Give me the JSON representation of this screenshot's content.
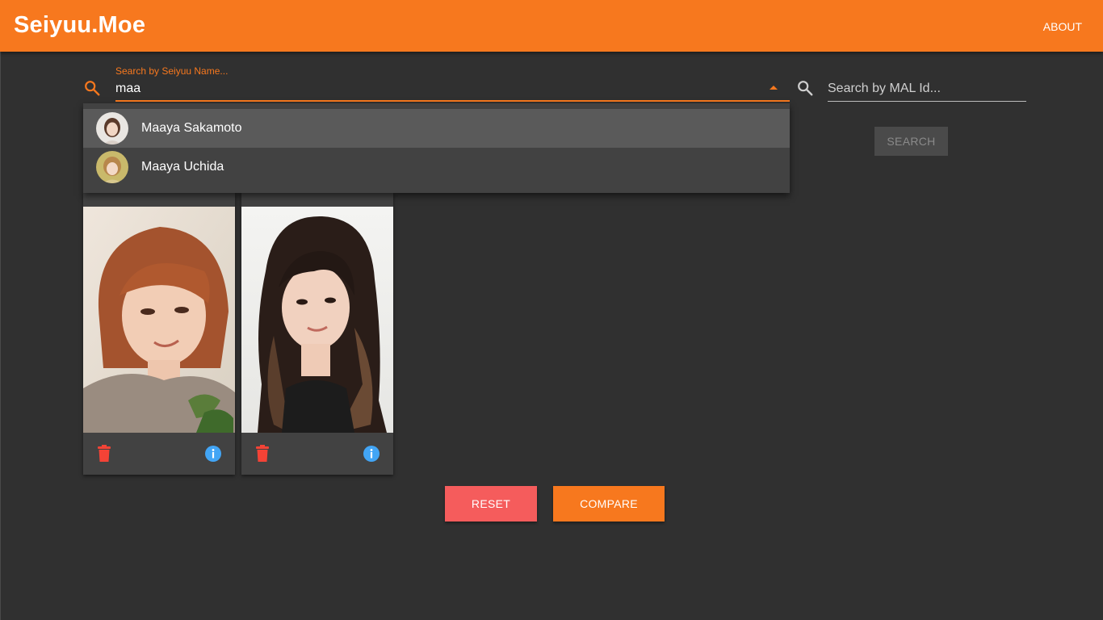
{
  "app": {
    "title": "Seiyuu.Moe",
    "about_label": "ABOUT"
  },
  "name_search": {
    "label": "Search by Seiyuu Name...",
    "value": "maa",
    "icon": "search-icon",
    "suggestions": [
      {
        "name": "Maaya Sakamoto",
        "highlighted": true
      },
      {
        "name": "Maaya Uchida",
        "highlighted": false
      }
    ]
  },
  "mal_search": {
    "placeholder": "Search by MAL Id...",
    "button_label": "SEARCH",
    "icon": "search-icon"
  },
  "cards": [
    {
      "delete_icon": "trash-icon",
      "info_icon": "info-icon"
    },
    {
      "delete_icon": "trash-icon",
      "info_icon": "info-icon"
    }
  ],
  "actions": {
    "reset_label": "RESET",
    "compare_label": "COMPARE"
  },
  "colors": {
    "accent": "#f7781e",
    "background": "#303030",
    "surface": "#424242",
    "reset": "#f55c5c",
    "delete": "#f44336",
    "info": "#42a5f5"
  }
}
